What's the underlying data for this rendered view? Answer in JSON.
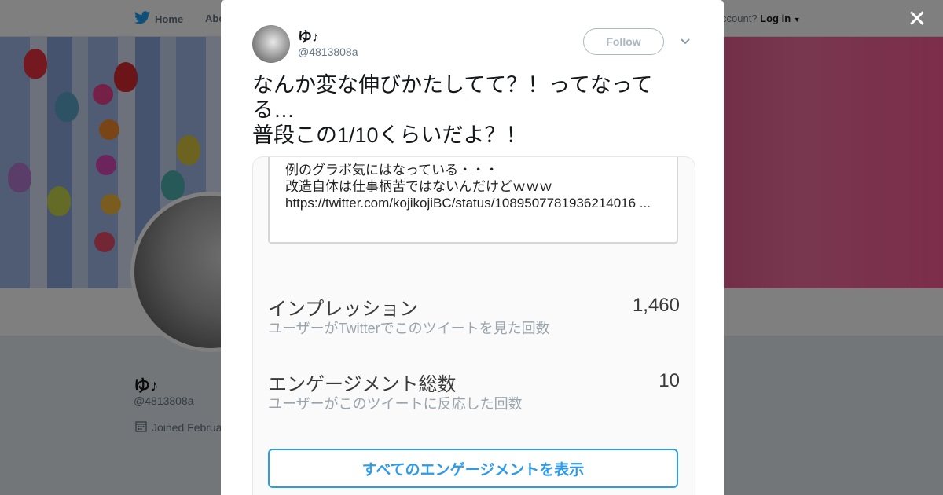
{
  "nav": {
    "home_label": "Home",
    "about_label": "Abo",
    "account_prompt": "ccount?",
    "login_label": "Log in"
  },
  "profile_bg": {
    "name": "ゆ♪",
    "handle": "@4813808a",
    "joined": "Joined Februa"
  },
  "close_glyph": "✕",
  "tweet": {
    "name": "ゆ♪",
    "handle": "@4813808a",
    "follow_label": "Follow",
    "text": "なんか変な伸びかたしてて？！ってなってる…\n普段この1/10くらいだよ？！"
  },
  "media": {
    "quote_text": "例のグラボ気にはなっている・・・\n改造自体は仕事柄苦ではないんだけどｗｗｗ\nhttps://twitter.com/kojikojiBC/status/1089507781936214016 ...",
    "stats": [
      {
        "label": "インプレッション",
        "sub": "ユーザーがTwitterでこのツイートを見た回数",
        "value": "1,460"
      },
      {
        "label": "エンゲージメント総数",
        "sub": "ユーザーがこのツイートに反応した回数",
        "value": "10"
      }
    ],
    "engage_button": "すべてのエンゲージメントを表示"
  },
  "colors": {
    "twitter_blue": "#1da1f2",
    "engage_blue": "#2f9be8",
    "overlay": "rgba(0,0,0,0.5)"
  },
  "icons": [
    "twitter-bird-icon",
    "caret-down-icon",
    "calendar-icon",
    "close-icon",
    "chevron-down-icon"
  ]
}
